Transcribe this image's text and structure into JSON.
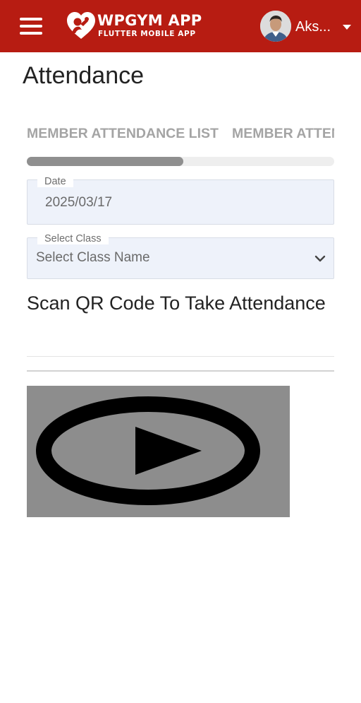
{
  "app": {
    "brand_title": "WPGYM APP",
    "brand_subtitle": "FLUTTER MOBILE APP",
    "brand_color": "#b71c12",
    "menu_icon": "hamburger-icon",
    "logo_icon": "heart-logo-icon"
  },
  "user": {
    "name": "Aks...",
    "avatar_icon": "user-avatar",
    "dropdown_icon": "caret-down-icon"
  },
  "page": {
    "title": "Attendance"
  },
  "tabs": [
    {
      "label": "MEMBER ATTENDANCE LIST"
    },
    {
      "label": "MEMBER ATTEN"
    }
  ],
  "tab_progress": 0.51,
  "date_field": {
    "label": "Date",
    "value": "2025/03/17"
  },
  "class_field": {
    "label": "Select Class",
    "value": "Select Class Name",
    "icon": "chevron-down-icon"
  },
  "scan": {
    "heading": "Scan QR Code To Take Attendance"
  },
  "video": {
    "icon": "play-icon"
  }
}
